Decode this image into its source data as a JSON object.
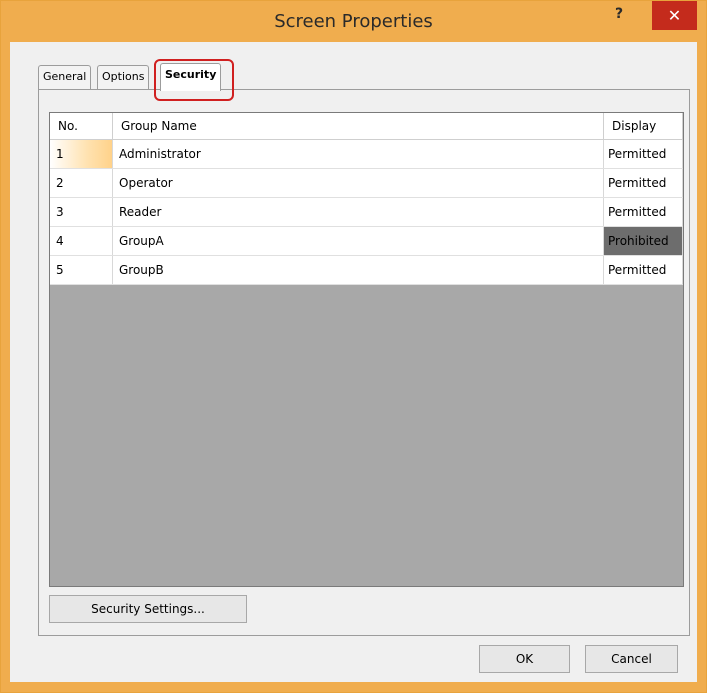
{
  "window": {
    "title": "Screen Properties",
    "help_label": "?",
    "close_label": "✕"
  },
  "tabs": [
    {
      "label": "General"
    },
    {
      "label": "Options"
    },
    {
      "label": "Security"
    }
  ],
  "table": {
    "headers": {
      "no": "No.",
      "group_name": "Group Name",
      "display": "Display"
    },
    "rows": [
      {
        "no": "1",
        "group_name": "Administrator",
        "display": "Permitted"
      },
      {
        "no": "2",
        "group_name": "Operator",
        "display": "Permitted"
      },
      {
        "no": "3",
        "group_name": "Reader",
        "display": "Permitted"
      },
      {
        "no": "4",
        "group_name": "GroupA",
        "display": "Prohibited"
      },
      {
        "no": "5",
        "group_name": "GroupB",
        "display": "Permitted"
      }
    ]
  },
  "buttons": {
    "security_settings": "Security Settings...",
    "ok": "OK",
    "cancel": "Cancel"
  },
  "colors": {
    "title_bar": "#f0ad4e",
    "close": "#c42b1c",
    "highlight": "#d02020",
    "prohibited": "#6d6d6d"
  }
}
